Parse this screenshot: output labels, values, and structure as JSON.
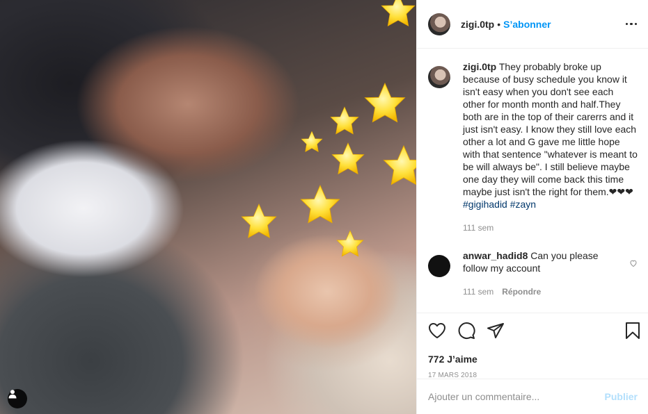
{
  "header": {
    "username": "zigi.0tp",
    "separator": "•",
    "follow_label": "S’abonner"
  },
  "caption": {
    "username": "zigi.0tp",
    "text": "They probably broke up because of busy schedule you know it isn't easy when you don't see each other for month month and half.They both are in the top of their carerrs and it just isn't easy. I know they still love each other a lot and G gave me little hope with that sentence \"whatever is meant to be will always be\". I still believe maybe one day they will come back this time maybe just isn't the right for them.❤❤❤",
    "hashtags": "#gigihadid #zayn",
    "age": "111 sem"
  },
  "comment": {
    "username": "anwar_hadid8",
    "text": "Can you please follow my account",
    "age": "111 sem",
    "reply_label": "Répondre"
  },
  "actions": {
    "likes": "772 J’aime",
    "date": "17 MARS 2018"
  },
  "add_comment": {
    "placeholder": "Ajouter un commentaire...",
    "post_label": "Publier"
  },
  "icons": {
    "like": "heart-icon",
    "comment": "comment-bubble-icon",
    "share": "paper-plane-icon",
    "save": "bookmark-icon",
    "more": "more-horizontal-icon",
    "tag": "user-tag-icon"
  },
  "colors": {
    "accent": "#0095f6",
    "muted": "#8e8e8e",
    "post_disabled": "#b2dffc",
    "hashtag": "#00376b"
  }
}
